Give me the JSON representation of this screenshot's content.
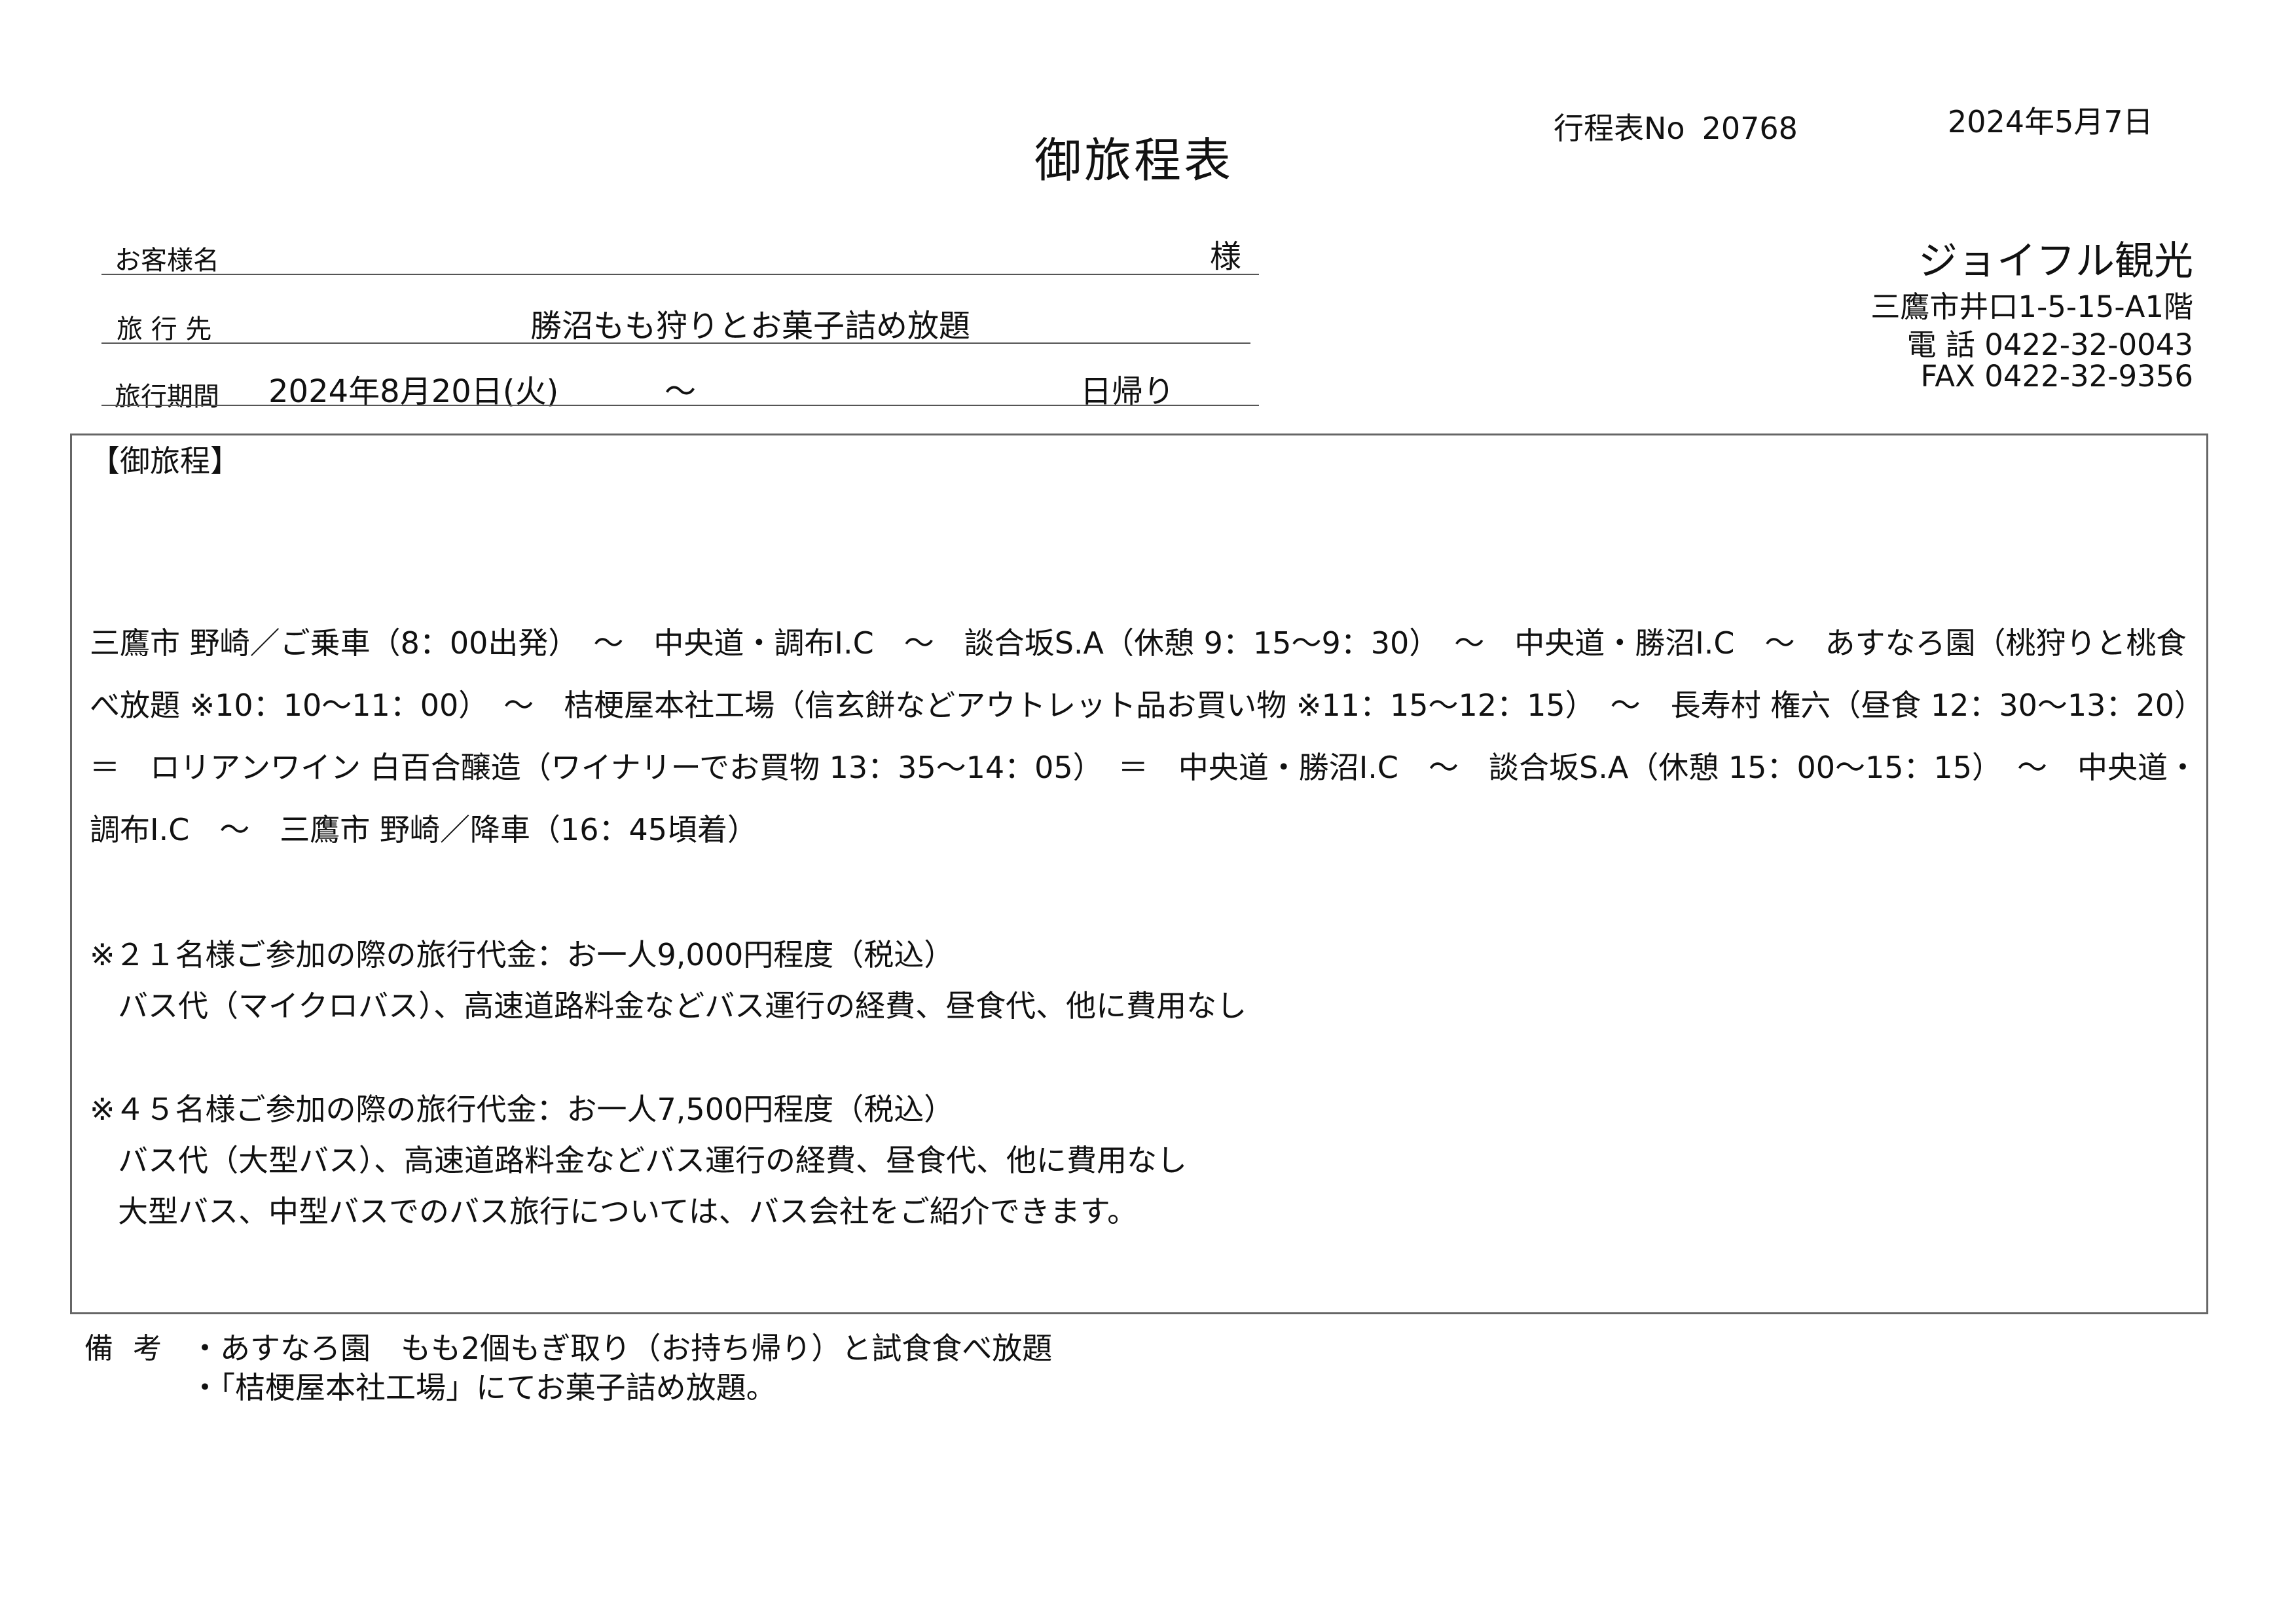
{
  "header": {
    "title": "御旅程表",
    "doc_number_label": "行程表No",
    "doc_number_value": "20768",
    "date": "2024年5月7日"
  },
  "fields": {
    "customer_label": "お客様名",
    "customer_name": "",
    "customer_suffix": "様",
    "destination_label": "旅 行 先",
    "destination_value": "勝沼もも狩りとお菓子詰め放題",
    "period_label": "旅行期間",
    "period_start": "2024年8月20日(火)",
    "period_tilde": "～",
    "period_end": "日帰り"
  },
  "company": {
    "name": "ジョイフル観光",
    "address": "三鷹市井口1-5-15-A1階",
    "phone": "電 話 0422-32-0043",
    "fax": "FAX 0422-32-9356"
  },
  "itinerary": {
    "heading": "【御旅程】",
    "route": "三鷹市 野崎／ご乗車（8：00出発）　～　中央道・調布I.C　～　談合坂S.A（休憩 9：15～9：30）　～　中央道・勝沼I.C　～　あすなろ園（桃狩りと桃食べ放題 ※10：10～11：00）　～　桔梗屋本社工場（信玄餅などアウトレット品お買い物 ※11：15～12：15）　～　長寿村 権六（昼食 12：30～13：20）　＝　ロリアンワイン 白百合醸造（ワイナリーでお買物 13：35～14：05）　＝　中央道・勝沼I.C　～　談合坂S.A（休憩 15：00～15：15）　～　中央道・調布I.C　～　三鷹市 野崎／降車（16：45頃着）",
    "notes": [
      "※２１名様ご参加の際の旅行代金：お一人9,000円程度（税込）",
      "バス代（マイクロバス）、高速道路料金などバス運行の経費、昼食代、他に費用なし",
      "※４５名様ご参加の際の旅行代金：お一人7,500円程度（税込）",
      "バス代（大型バス）、高速道路料金などバス運行の経費、昼食代、他に費用なし",
      "大型バス、中型バスでのバス旅行については、バス会社をご紹介できます。"
    ]
  },
  "remarks": {
    "label": "備考",
    "items": [
      "・あすなろ園　もも2個もぎ取り（お持ち帰り）と試食食べ放題",
      "・「桔梗屋本社工場」にてお菓子詰め放題。"
    ]
  }
}
